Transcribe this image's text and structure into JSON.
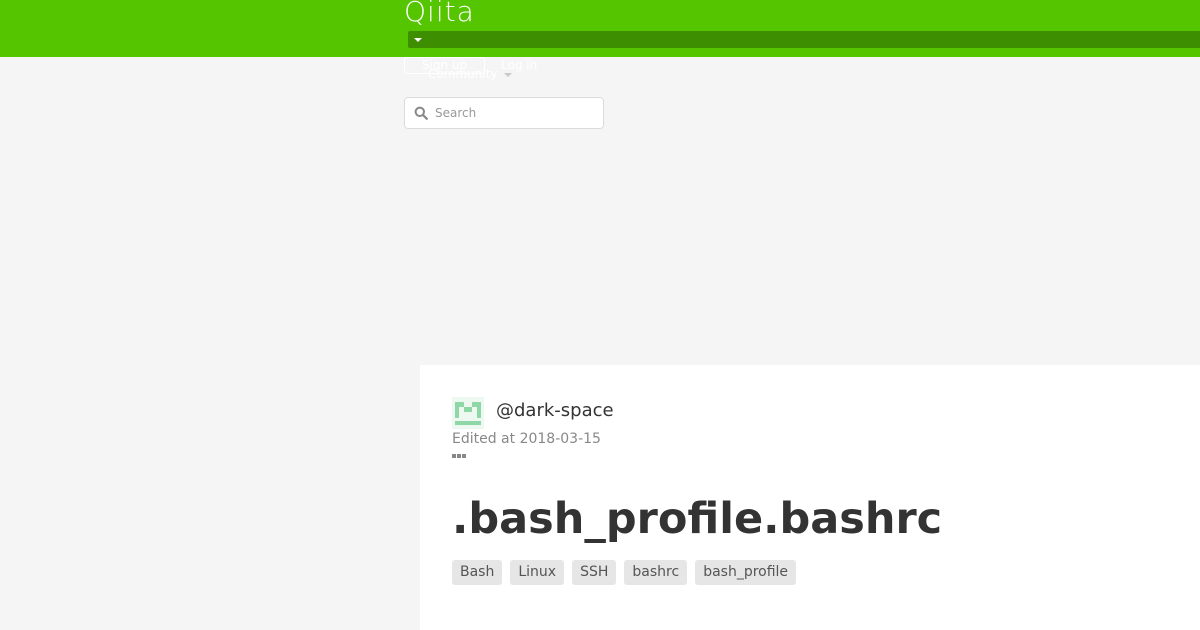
{
  "header": {
    "logo": "Qiita",
    "signup_label": "Sign up",
    "login_label": "Log in",
    "community_label": "Community",
    "search": {
      "placeholder": "Search"
    }
  },
  "article": {
    "author": "@dark-space",
    "edited": "Edited at 2018-03-15",
    "title": ".bash_profile.bashrc",
    "tags": [
      "Bash",
      "Linux",
      "SSH",
      "bashrc",
      "bash_profile"
    ]
  },
  "colors": {
    "brand": "#55c500",
    "brand_dark": "#3d8e00"
  }
}
